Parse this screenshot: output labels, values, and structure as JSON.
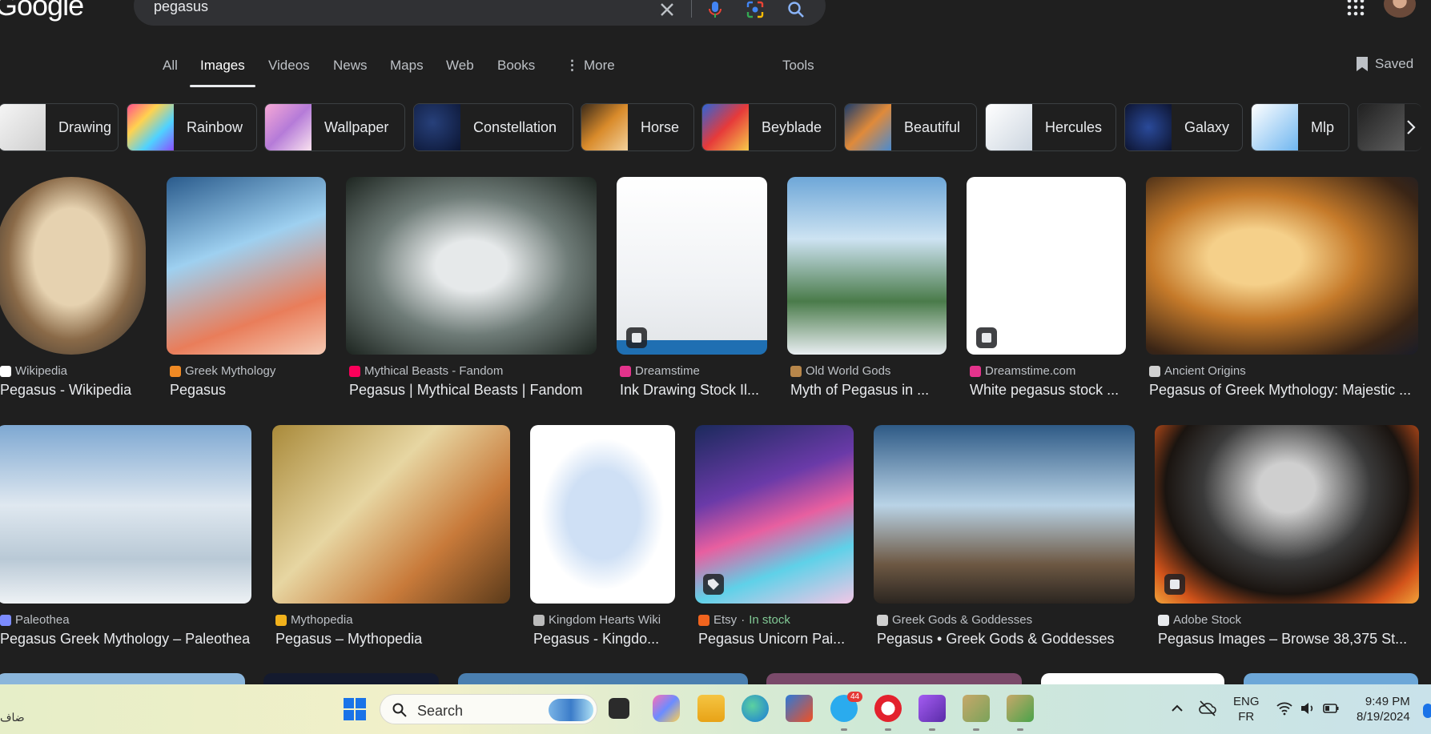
{
  "header": {
    "logo": "Google",
    "query": "pegasus",
    "colors": {
      "background": "#1f1f1f",
      "searchbox": "#303134",
      "text": "#e8eaed",
      "muted": "#bdc1c6"
    },
    "icons": [
      "clear-icon",
      "mic-icon",
      "lens-icon",
      "search-icon",
      "apps-icon"
    ]
  },
  "tabs": {
    "items": [
      "All",
      "Images",
      "Videos",
      "News",
      "Maps",
      "Web",
      "Books",
      "More"
    ],
    "active": "Images",
    "tools": "Tools",
    "saved": "Saved"
  },
  "chips": [
    "Drawing",
    "Rainbow",
    "Wallpaper",
    "Constellation",
    "Horse",
    "Beyblade",
    "Beautiful",
    "Hercules",
    "Galaxy",
    "Mlp"
  ],
  "results_row1": [
    {
      "source": "Wikipedia",
      "title": "Pegasus - Wikipedia"
    },
    {
      "source": "Greek Mythology",
      "title": "Pegasus"
    },
    {
      "source": "Mythical Beasts - Fandom",
      "title": "Pegasus | Mythical Beasts | Fandom"
    },
    {
      "source": "Dreamstime",
      "title": "Ink Drawing Stock Il..."
    },
    {
      "source": "Old World Gods",
      "title": "Myth of Pegasus in ..."
    },
    {
      "source": "Dreamstime.com",
      "title": "White pegasus stock ..."
    },
    {
      "source": "Ancient Origins",
      "title": "Pegasus of Greek Mythology: Majestic ..."
    }
  ],
  "results_row2": [
    {
      "source": "Paleothea",
      "title": "Pegasus Greek Mythology – Paleothea"
    },
    {
      "source": "Mythopedia",
      "title": "Pegasus – Mythopedia"
    },
    {
      "source": "Kingdom Hearts Wiki",
      "title": "Pegasus - Kingdo..."
    },
    {
      "source": "Etsy",
      "stock_sep": "·",
      "stock": "In stock",
      "title": "Pegasus Unicorn Pai..."
    },
    {
      "source": "Greek Gods & Goddesses",
      "title": "Pegasus • Greek Gods & Goddesses"
    },
    {
      "source": "Adobe Stock",
      "title": "Pegasus Images – Browse 38,375 St..."
    }
  ],
  "taskbar": {
    "left_text": "ضاف",
    "search_label": "Search",
    "telegram_badge": "44",
    "lang_top": "ENG",
    "lang_bottom": "FR",
    "time": "9:49 PM",
    "date": "8/19/2024"
  }
}
